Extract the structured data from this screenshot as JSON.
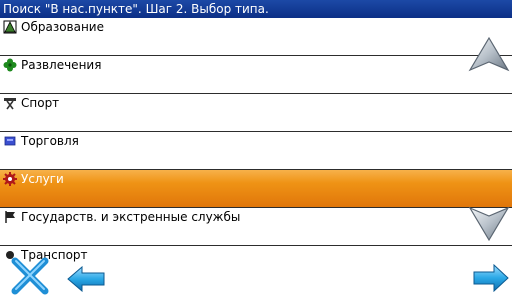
{
  "title": "Поиск \"В нас.пункте\". Шаг 2. Выбор типа.",
  "items": [
    {
      "label": "Образование",
      "icon": "school-icon"
    },
    {
      "label": "Развлечения",
      "icon": "entertainment-icon"
    },
    {
      "label": "Спорт",
      "icon": "sport-icon"
    },
    {
      "label": "Торговля",
      "icon": "shop-icon"
    },
    {
      "label": "Услуги",
      "icon": "services-icon"
    },
    {
      "label": "Государств. и экстренные службы",
      "icon": "flag-icon"
    },
    {
      "label": "Транспорт",
      "icon": "transport-icon"
    }
  ],
  "selected_index": 4,
  "colors": {
    "title_bg": "#0c2f86",
    "selection": "#ef9315",
    "arrow_blue": "#2aa8e6"
  }
}
